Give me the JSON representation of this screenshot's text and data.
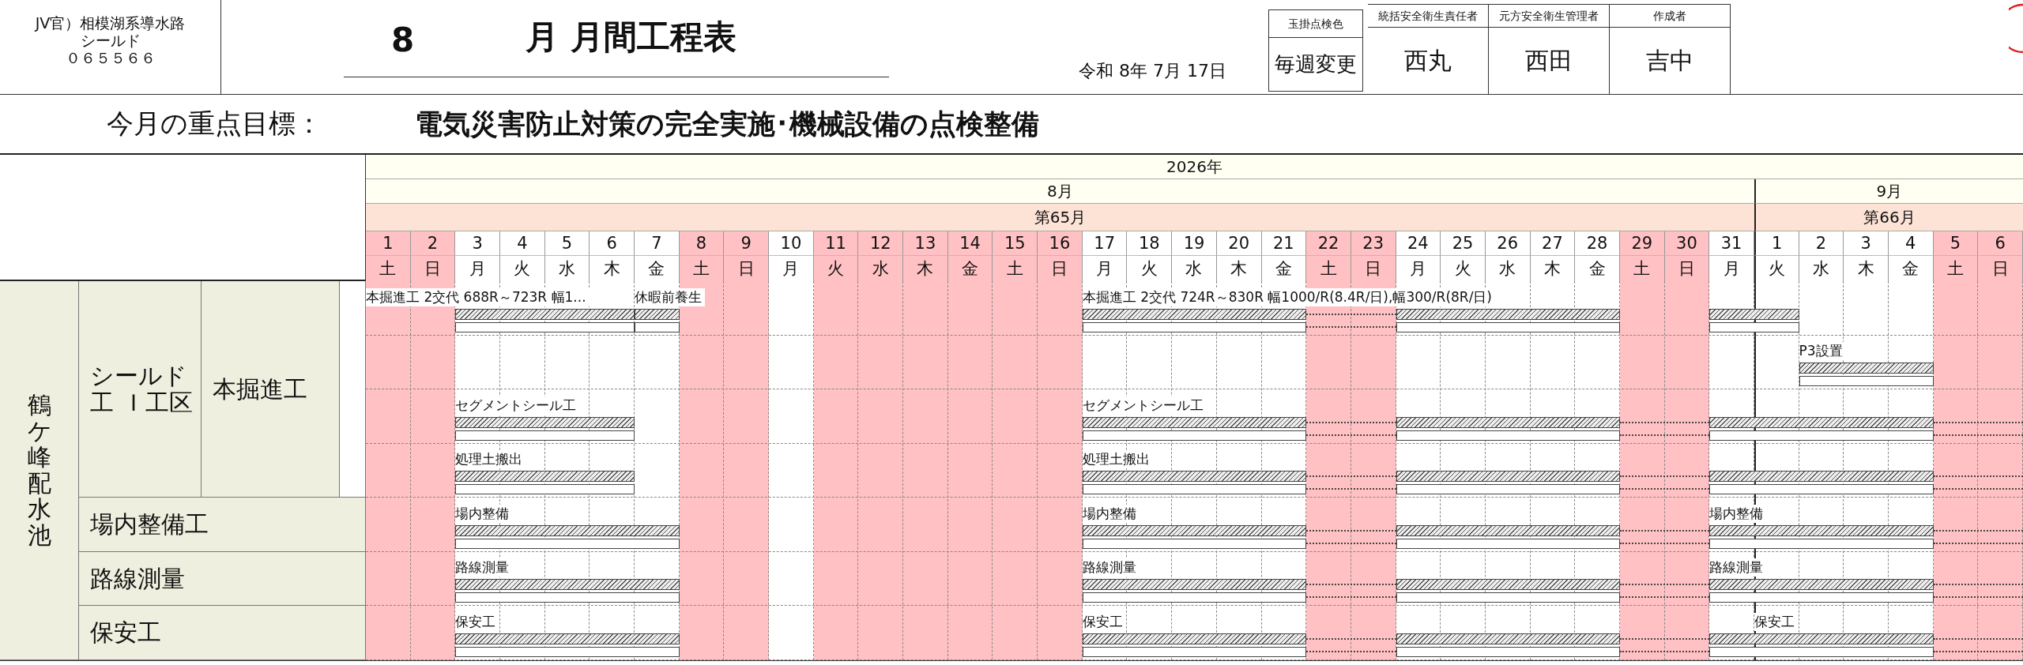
{
  "header": {
    "office": [
      "JV官）相模湖系導水路",
      "シールド",
      "０６５５６６"
    ],
    "title_month": "8",
    "title": "月 月間工程表",
    "date": "令和 8年 7月 17日",
    "inspection": {
      "label": "玉掛点検色",
      "value": "毎週変更"
    },
    "signatures": [
      {
        "role": "統括安全衛生責任者",
        "name": "西丸"
      },
      {
        "role": "元方安全衛生管理者",
        "name": "西田"
      },
      {
        "role": "作成者",
        "name": "吉中"
      }
    ]
  },
  "goal": {
    "label": "今月の重点目標：",
    "text": "電気災害防止対策の完全実施･機械設備の点検整備"
  },
  "calendar": {
    "year": "2026年",
    "months": [
      {
        "label": "8月",
        "period": "第65月",
        "days": [
          {
            "day": "1",
            "weekday": "土",
            "holiday": true
          },
          {
            "day": "2",
            "weekday": "日",
            "holiday": true
          },
          {
            "day": "3",
            "weekday": "月",
            "holiday": false
          },
          {
            "day": "4",
            "weekday": "火",
            "holiday": false
          },
          {
            "day": "5",
            "weekday": "水",
            "holiday": false
          },
          {
            "day": "6",
            "weekday": "木",
            "holiday": false
          },
          {
            "day": "7",
            "weekday": "金",
            "holiday": false
          },
          {
            "day": "8",
            "weekday": "土",
            "holiday": true
          },
          {
            "day": "9",
            "weekday": "日",
            "holiday": true
          },
          {
            "day": "10",
            "weekday": "月",
            "holiday": false
          },
          {
            "day": "11",
            "weekday": "火",
            "holiday": true
          },
          {
            "day": "12",
            "weekday": "水",
            "holiday": true
          },
          {
            "day": "13",
            "weekday": "木",
            "holiday": true
          },
          {
            "day": "14",
            "weekday": "金",
            "holiday": true
          },
          {
            "day": "15",
            "weekday": "土",
            "holiday": true
          },
          {
            "day": "16",
            "weekday": "日",
            "holiday": true
          },
          {
            "day": "17",
            "weekday": "月",
            "holiday": false
          },
          {
            "day": "18",
            "weekday": "火",
            "holiday": false
          },
          {
            "day": "19",
            "weekday": "水",
            "holiday": false
          },
          {
            "day": "20",
            "weekday": "木",
            "holiday": false
          },
          {
            "day": "21",
            "weekday": "金",
            "holiday": false
          },
          {
            "day": "22",
            "weekday": "土",
            "holiday": true
          },
          {
            "day": "23",
            "weekday": "日",
            "holiday": true
          },
          {
            "day": "24",
            "weekday": "月",
            "holiday": false
          },
          {
            "day": "25",
            "weekday": "火",
            "holiday": false
          },
          {
            "day": "26",
            "weekday": "水",
            "holiday": false
          },
          {
            "day": "27",
            "weekday": "木",
            "holiday": false
          },
          {
            "day": "28",
            "weekday": "金",
            "holiday": false
          },
          {
            "day": "29",
            "weekday": "土",
            "holiday": true
          },
          {
            "day": "30",
            "weekday": "日",
            "holiday": true
          },
          {
            "day": "31",
            "weekday": "月",
            "holiday": false
          }
        ]
      },
      {
        "label": "9月",
        "period": "第66月",
        "days": [
          {
            "day": "1",
            "weekday": "火",
            "holiday": false
          },
          {
            "day": "2",
            "weekday": "水",
            "holiday": false
          },
          {
            "day": "3",
            "weekday": "木",
            "holiday": false
          },
          {
            "day": "4",
            "weekday": "金",
            "holiday": false
          },
          {
            "day": "5",
            "weekday": "土",
            "holiday": true
          },
          {
            "day": "6",
            "weekday": "日",
            "holiday": true
          }
        ]
      }
    ]
  },
  "site": "鶴ケ峰配水池",
  "work_items": [
    {
      "label": [
        "シールド",
        "工 Ｉ工区"
      ],
      "sub_label": "本掘進工",
      "rows": [
        {
          "cells": [
            {
              "kind": "none",
              "label": "本掘進工 2交代 688R～723R 幅1..."
            },
            {
              "kind": "none"
            },
            {
              "kind": "bar"
            },
            {
              "kind": "bar"
            },
            {
              "kind": "bar"
            },
            {
              "kind": "bar"
            },
            {
              "kind": "bar_start",
              "label": "休暇前養生"
            },
            {
              "kind": "none"
            },
            {
              "kind": "none"
            },
            {
              "kind": "none"
            },
            {
              "kind": "none"
            },
            {
              "kind": "none"
            },
            {
              "kind": "none"
            },
            {
              "kind": "none"
            },
            {
              "kind": "none"
            },
            {
              "kind": "none"
            },
            {
              "kind": "bar",
              "label": "本掘進工 2交代 724R～830R 幅1000/R(8.4R/日),幅300/R(8R/日)"
            },
            {
              "kind": "bar"
            },
            {
              "kind": "bar"
            },
            {
              "kind": "bar"
            },
            {
              "kind": "bar"
            },
            {
              "kind": "dotted"
            },
            {
              "kind": "dotted"
            },
            {
              "kind": "bar"
            },
            {
              "kind": "bar"
            },
            {
              "kind": "bar"
            },
            {
              "kind": "bar"
            },
            {
              "kind": "bar"
            },
            {
              "kind": "none"
            },
            {
              "kind": "none"
            },
            {
              "kind": "bar"
            },
            {
              "kind": "bar"
            },
            {
              "kind": "none"
            },
            {
              "kind": "none"
            },
            {
              "kind": "none"
            },
            {
              "kind": "none"
            },
            {
              "kind": "none"
            }
          ]
        },
        {
          "cells": [
            {
              "kind": "none"
            },
            {
              "kind": "none"
            },
            {
              "kind": "none"
            },
            {
              "kind": "none"
            },
            {
              "kind": "none"
            },
            {
              "kind": "none"
            },
            {
              "kind": "none"
            },
            {
              "kind": "none"
            },
            {
              "kind": "none"
            },
            {
              "kind": "none"
            },
            {
              "kind": "none"
            },
            {
              "kind": "none"
            },
            {
              "kind": "none"
            },
            {
              "kind": "none"
            },
            {
              "kind": "none"
            },
            {
              "kind": "none"
            },
            {
              "kind": "none"
            },
            {
              "kind": "none"
            },
            {
              "kind": "none"
            },
            {
              "kind": "none"
            },
            {
              "kind": "none"
            },
            {
              "kind": "none"
            },
            {
              "kind": "none"
            },
            {
              "kind": "none"
            },
            {
              "kind": "none"
            },
            {
              "kind": "none"
            },
            {
              "kind": "none"
            },
            {
              "kind": "none"
            },
            {
              "kind": "none"
            },
            {
              "kind": "none"
            },
            {
              "kind": "none"
            },
            {
              "kind": "none"
            },
            {
              "kind": "bar",
              "label": "P3設置"
            },
            {
              "kind": "bar"
            },
            {
              "kind": "bar"
            },
            {
              "kind": "none"
            },
            {
              "kind": "none"
            }
          ]
        },
        {
          "cells": [
            {
              "kind": "none"
            },
            {
              "kind": "none"
            },
            {
              "kind": "bar",
              "label": "セグメントシール工"
            },
            {
              "kind": "bar"
            },
            {
              "kind": "bar"
            },
            {
              "kind": "bar"
            },
            {
              "kind": "none"
            },
            {
              "kind": "none"
            },
            {
              "kind": "none"
            },
            {
              "kind": "none"
            },
            {
              "kind": "none"
            },
            {
              "kind": "none"
            },
            {
              "kind": "none"
            },
            {
              "kind": "none"
            },
            {
              "kind": "none"
            },
            {
              "kind": "none"
            },
            {
              "kind": "bar",
              "label": "セグメントシール工"
            },
            {
              "kind": "bar"
            },
            {
              "kind": "bar"
            },
            {
              "kind": "bar"
            },
            {
              "kind": "bar"
            },
            {
              "kind": "dotted"
            },
            {
              "kind": "dotted"
            },
            {
              "kind": "bar"
            },
            {
              "kind": "bar"
            },
            {
              "kind": "bar"
            },
            {
              "kind": "bar"
            },
            {
              "kind": "bar"
            },
            {
              "kind": "dotted"
            },
            {
              "kind": "dotted"
            },
            {
              "kind": "bar"
            },
            {
              "kind": "bar"
            },
            {
              "kind": "bar"
            },
            {
              "kind": "bar"
            },
            {
              "kind": "bar"
            },
            {
              "kind": "dotted"
            },
            {
              "kind": "dotted"
            }
          ]
        },
        {
          "cells": [
            {
              "kind": "none"
            },
            {
              "kind": "none"
            },
            {
              "kind": "bar",
              "label": "処理土搬出"
            },
            {
              "kind": "bar"
            },
            {
              "kind": "bar"
            },
            {
              "kind": "bar"
            },
            {
              "kind": "none"
            },
            {
              "kind": "none"
            },
            {
              "kind": "none"
            },
            {
              "kind": "none"
            },
            {
              "kind": "none"
            },
            {
              "kind": "none"
            },
            {
              "kind": "none"
            },
            {
              "kind": "none"
            },
            {
              "kind": "none"
            },
            {
              "kind": "none"
            },
            {
              "kind": "bar",
              "label": "処理土搬出"
            },
            {
              "kind": "bar"
            },
            {
              "kind": "bar"
            },
            {
              "kind": "bar"
            },
            {
              "kind": "bar"
            },
            {
              "kind": "dotted"
            },
            {
              "kind": "dotted"
            },
            {
              "kind": "bar"
            },
            {
              "kind": "bar"
            },
            {
              "kind": "bar"
            },
            {
              "kind": "bar"
            },
            {
              "kind": "bar"
            },
            {
              "kind": "dotted"
            },
            {
              "kind": "dotted"
            },
            {
              "kind": "bar"
            },
            {
              "kind": "bar"
            },
            {
              "kind": "bar"
            },
            {
              "kind": "bar"
            },
            {
              "kind": "bar"
            },
            {
              "kind": "dotted"
            },
            {
              "kind": "dotted"
            }
          ]
        }
      ]
    },
    {
      "label": [
        "場内整備工"
      ],
      "rows": [
        {
          "cells": [
            {
              "kind": "none"
            },
            {
              "kind": "none"
            },
            {
              "kind": "bar",
              "label": "場内整備"
            },
            {
              "kind": "bar"
            },
            {
              "kind": "bar"
            },
            {
              "kind": "bar"
            },
            {
              "kind": "bar"
            },
            {
              "kind": "none"
            },
            {
              "kind": "none"
            },
            {
              "kind": "none"
            },
            {
              "kind": "none"
            },
            {
              "kind": "none"
            },
            {
              "kind": "none"
            },
            {
              "kind": "none"
            },
            {
              "kind": "none"
            },
            {
              "kind": "none"
            },
            {
              "kind": "bar",
              "label": "場内整備"
            },
            {
              "kind": "bar"
            },
            {
              "kind": "bar"
            },
            {
              "kind": "bar"
            },
            {
              "kind": "bar"
            },
            {
              "kind": "dotted"
            },
            {
              "kind": "dotted"
            },
            {
              "kind": "bar"
            },
            {
              "kind": "bar"
            },
            {
              "kind": "bar"
            },
            {
              "kind": "bar"
            },
            {
              "kind": "bar"
            },
            {
              "kind": "dotted"
            },
            {
              "kind": "dotted"
            },
            {
              "kind": "bar",
              "label": "場内整備"
            },
            {
              "kind": "bar"
            },
            {
              "kind": "bar"
            },
            {
              "kind": "bar"
            },
            {
              "kind": "bar"
            },
            {
              "kind": "dotted"
            },
            {
              "kind": "dotted"
            }
          ]
        }
      ]
    },
    {
      "label": [
        "路線測量"
      ],
      "rows": [
        {
          "cells": [
            {
              "kind": "none"
            },
            {
              "kind": "none"
            },
            {
              "kind": "bar",
              "label": "路線測量"
            },
            {
              "kind": "bar"
            },
            {
              "kind": "bar"
            },
            {
              "kind": "bar"
            },
            {
              "kind": "bar"
            },
            {
              "kind": "none"
            },
            {
              "kind": "none"
            },
            {
              "kind": "none"
            },
            {
              "kind": "none"
            },
            {
              "kind": "none"
            },
            {
              "kind": "none"
            },
            {
              "kind": "none"
            },
            {
              "kind": "none"
            },
            {
              "kind": "none"
            },
            {
              "kind": "bar",
              "label": "路線測量"
            },
            {
              "kind": "bar"
            },
            {
              "kind": "bar"
            },
            {
              "kind": "bar"
            },
            {
              "kind": "bar"
            },
            {
              "kind": "dotted"
            },
            {
              "kind": "dotted"
            },
            {
              "kind": "bar"
            },
            {
              "kind": "bar"
            },
            {
              "kind": "bar"
            },
            {
              "kind": "bar"
            },
            {
              "kind": "bar"
            },
            {
              "kind": "dotted"
            },
            {
              "kind": "dotted"
            },
            {
              "kind": "bar",
              "label": "路線測量"
            },
            {
              "kind": "bar"
            },
            {
              "kind": "bar"
            },
            {
              "kind": "bar"
            },
            {
              "kind": "bar"
            },
            {
              "kind": "dotted"
            },
            {
              "kind": "dotted"
            }
          ]
        }
      ]
    },
    {
      "label": [
        "保安工"
      ],
      "rows": [
        {
          "cells": [
            {
              "kind": "none"
            },
            {
              "kind": "none"
            },
            {
              "kind": "bar",
              "label": "保安工"
            },
            {
              "kind": "bar"
            },
            {
              "kind": "bar"
            },
            {
              "kind": "bar"
            },
            {
              "kind": "bar"
            },
            {
              "kind": "none"
            },
            {
              "kind": "none"
            },
            {
              "kind": "none"
            },
            {
              "kind": "none"
            },
            {
              "kind": "none"
            },
            {
              "kind": "none"
            },
            {
              "kind": "none"
            },
            {
              "kind": "none"
            },
            {
              "kind": "none"
            },
            {
              "kind": "bar",
              "label": "保安工"
            },
            {
              "kind": "bar"
            },
            {
              "kind": "bar"
            },
            {
              "kind": "bar"
            },
            {
              "kind": "bar"
            },
            {
              "kind": "dotted"
            },
            {
              "kind": "dotted"
            },
            {
              "kind": "bar"
            },
            {
              "kind": "bar"
            },
            {
              "kind": "bar"
            },
            {
              "kind": "bar"
            },
            {
              "kind": "bar"
            },
            {
              "kind": "dotted"
            },
            {
              "kind": "dotted"
            },
            {
              "kind": "bar"
            },
            {
              "kind": "bar",
              "label": "保安工"
            },
            {
              "kind": "bar"
            },
            {
              "kind": "bar"
            },
            {
              "kind": "bar"
            },
            {
              "kind": "dotted"
            },
            {
              "kind": "dotted"
            }
          ]
        }
      ]
    }
  ]
}
